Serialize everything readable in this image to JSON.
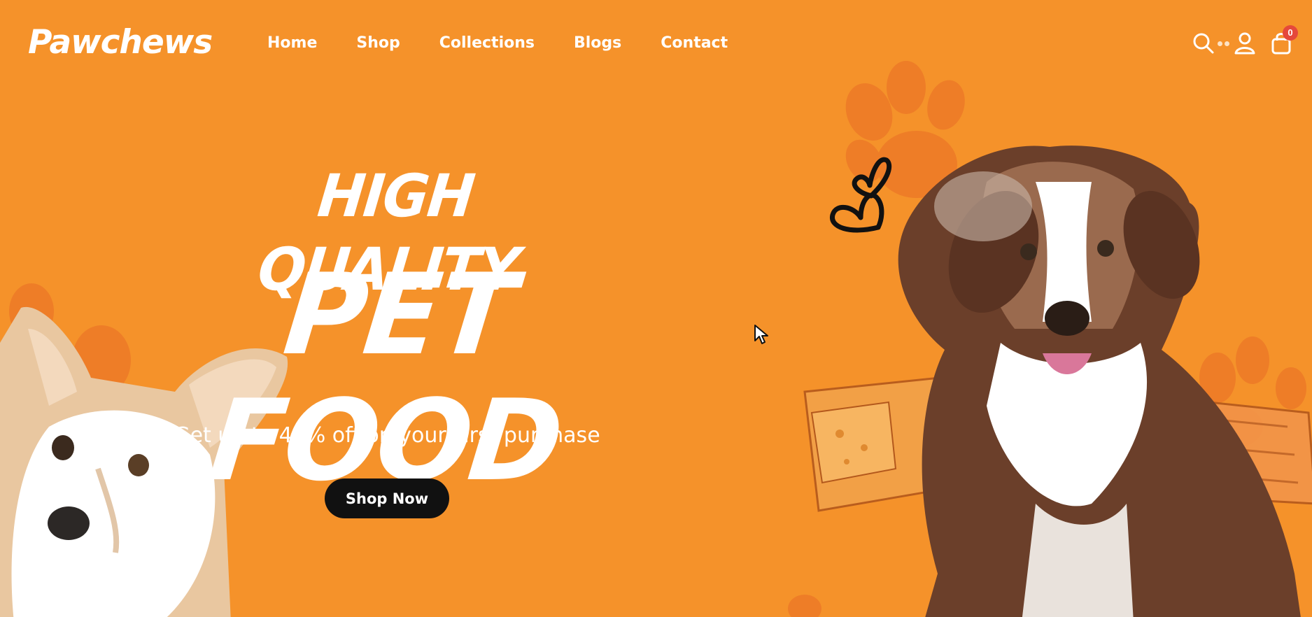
{
  "brand": {
    "name": "Pawchews"
  },
  "nav": {
    "items": [
      {
        "label": "Home"
      },
      {
        "label": "Shop"
      },
      {
        "label": "Collections"
      },
      {
        "label": "Blogs"
      },
      {
        "label": "Contact"
      }
    ]
  },
  "header_icons": {
    "search": "search-icon",
    "account": "user-icon",
    "cart": "shopping-bag-icon",
    "cart_count": "0"
  },
  "hero": {
    "subtitle": "HIGH QUALITY",
    "title": "PET FOOD",
    "offer": "Get up to 40% off on your First purchase",
    "cta_label": "Shop Now"
  },
  "colors": {
    "background": "#f5922a",
    "paw_print": "#ec7a28",
    "text": "#ffffff",
    "button": "#111111",
    "badge": "#e5483b"
  }
}
